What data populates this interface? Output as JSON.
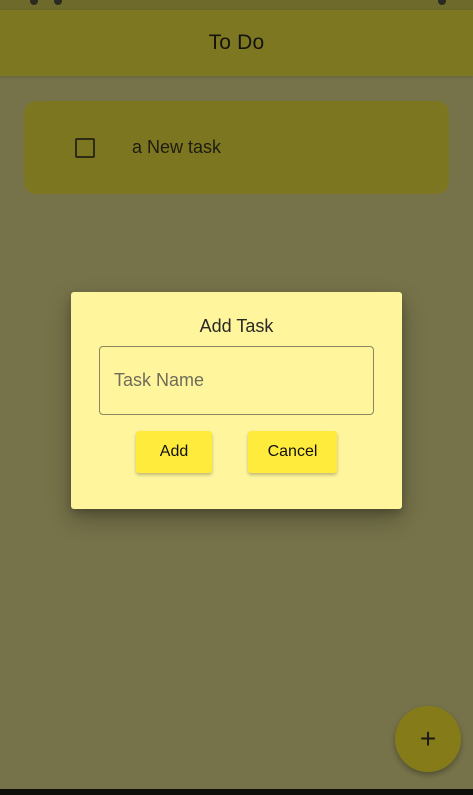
{
  "app_bar": {
    "title": "To Do"
  },
  "tasks": [
    {
      "label": "a New task",
      "checked": false
    }
  ],
  "dialog": {
    "title": "Add Task",
    "input": {
      "placeholder": "Task Name",
      "value": ""
    },
    "add_label": "Add",
    "cancel_label": "Cancel"
  },
  "fab": {
    "icon": "plus-icon",
    "glyph": "+"
  },
  "colors": {
    "accent": "#ffeb3b",
    "dialog_bg": "#fff59d",
    "scrim_bg": "#76734a"
  }
}
